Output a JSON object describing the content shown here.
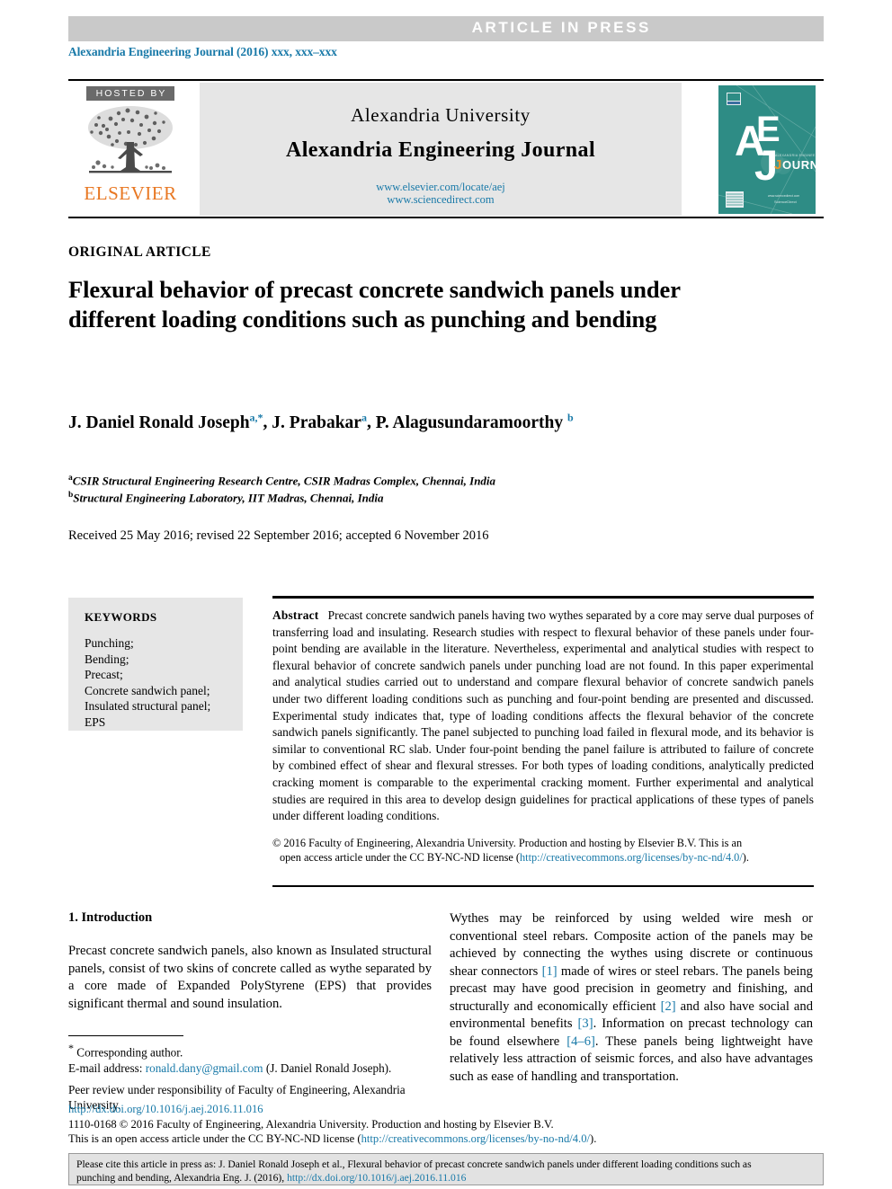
{
  "banner": {
    "press_label": "ARTICLE IN PRESS",
    "journal_reference": "Alexandria Engineering Journal (2016) xxx, xxx–xxx"
  },
  "masthead": {
    "hosted_by": "HOSTED BY",
    "publisher_name": "ELSEVIER",
    "university": "Alexandria University",
    "journal_title": "Alexandria Engineering Journal",
    "url_locate": "www.elsevier.com/locate/aej",
    "url_sciencedirect": "www.sciencedirect.com",
    "cover_letters": "AEJ",
    "cover_journal_word": "JOURNAL",
    "cover_top_small": "ALEXANDRIA ENGINEERING",
    "cover_color": "#2e8c85"
  },
  "article": {
    "type_label": "ORIGINAL ARTICLE",
    "title": "Flexural behavior of precast concrete sandwich panels under different loading conditions such as punching and bending",
    "authors": [
      {
        "name": "J. Daniel Ronald Joseph",
        "sup": "a,*"
      },
      {
        "name": "J. Prabakar",
        "sup": "a"
      },
      {
        "name": "P. Alagusundaramoorthy",
        "sup": "b"
      }
    ],
    "affiliations": [
      {
        "marker": "a",
        "text": "CSIR Structural Engineering Research Centre, CSIR Madras Complex, Chennai, India"
      },
      {
        "marker": "b",
        "text": "Structural Engineering Laboratory, IIT Madras, Chennai, India"
      }
    ],
    "history": "Received 25 May 2016; revised 22 September 2016; accepted 6 November 2016"
  },
  "keywords": {
    "heading": "KEYWORDS",
    "items": [
      "Punching;",
      "Bending;",
      "Precast;",
      "Concrete sandwich panel;",
      "Insulated structural panel;",
      "EPS"
    ]
  },
  "abstract": {
    "label": "Abstract",
    "text": "Precast concrete sandwich panels having two wythes separated by a core may serve dual purposes of transferring load and insulating. Research studies with respect to flexural behavior of these panels under four-point bending are available in the literature. Nevertheless, experimental and analytical studies with respect to flexural behavior of concrete sandwich panels under punching load are not found. In this paper experimental and analytical studies carried out to understand and compare flexural behavior of concrete sandwich panels under two different loading conditions such as punching and four-point bending are presented and discussed. Experimental study indicates that, type of loading conditions affects the flexural behavior of the concrete sandwich panels significantly. The panel subjected to punching load failed in flexural mode, and its behavior is similar to conventional RC slab. Under four-point bending the panel failure is attributed to failure of concrete by combined effect of shear and flexural stresses. For both types of loading conditions, analytically predicted cracking moment is comparable to the experimental cracking moment. Further experimental and analytical studies are required in this area to develop design guidelines for practical applications of these types of panels under different loading conditions.",
    "copyright_line1": "© 2016 Faculty of Engineering, Alexandria University. Production and hosting by Elsevier B.V. This is an",
    "copyright_line2_pre": "open access article under the CC BY-NC-ND license (",
    "copyright_license_url": "http://creativecommons.org/licenses/by-nc-nd/4.0/",
    "copyright_line2_post": ")."
  },
  "introduction": {
    "heading": "1. Introduction",
    "paragraph_left": "Precast concrete sandwich panels, also known as Insulated structural panels, consist of two skins of concrete called as wythe separated by a core made of Expanded PolyStyrene (EPS) that provides significant thermal and sound insulation.",
    "paragraph_right_part1": "Wythes may be reinforced by using welded wire mesh or conventional steel rebars. Composite action of the panels may be achieved by connecting the wythes using discrete or continuous shear connectors ",
    "ref1": "[1]",
    "paragraph_right_part2": " made of wires or steel rebars. The panels being precast may have good precision in geometry and finishing, and structurally and economically efficient ",
    "ref2": "[2]",
    "paragraph_right_part3": " and also have social and environmental benefits ",
    "ref3": "[3]",
    "paragraph_right_part4": ". Information on precast technology can be found elsewhere ",
    "ref4": "[4–6]",
    "paragraph_right_part5": ". These panels being lightweight have relatively less attraction of seismic forces, and also have advantages such as ease of handling and transportation."
  },
  "footnotes": {
    "corresponding_star": "*",
    "corresponding_text": "Corresponding author.",
    "email_label": "E-mail address:",
    "email": "ronald.dany@gmail.com",
    "email_owner": "(J. Daniel Ronald Joseph).",
    "peer_review": "Peer review under responsibility of Faculty of Engineering, Alexandria University."
  },
  "publication": {
    "doi_url": "http://dx.doi.org/10.1016/j.aej.2016.11.016",
    "issn_line": "1110-0168 © 2016 Faculty of Engineering, Alexandria University. Production and hosting by Elsevier B.V.",
    "license_pre": "This is an open access article under the CC BY-NC-ND license (",
    "license_url": "http://creativecommons.org/licenses/by-no-nd/4.0/",
    "license_post": ")."
  },
  "cite_box": {
    "line1": "Please cite this article in press as: J. Daniel Ronald Joseph et al., Flexural behavior of precast concrete sandwich panels under different loading conditions such as",
    "line2_pre": "punching and bending,  Alexandria Eng. J. (2016), ",
    "line2_url": "http://dx.doi.org/10.1016/j.aej.2016.11.016"
  },
  "colors": {
    "link": "#1879a8",
    "banner_gray": "#c9c9c9",
    "panel_gray": "#e6e6e6",
    "elsevier_orange": "#e87722"
  }
}
